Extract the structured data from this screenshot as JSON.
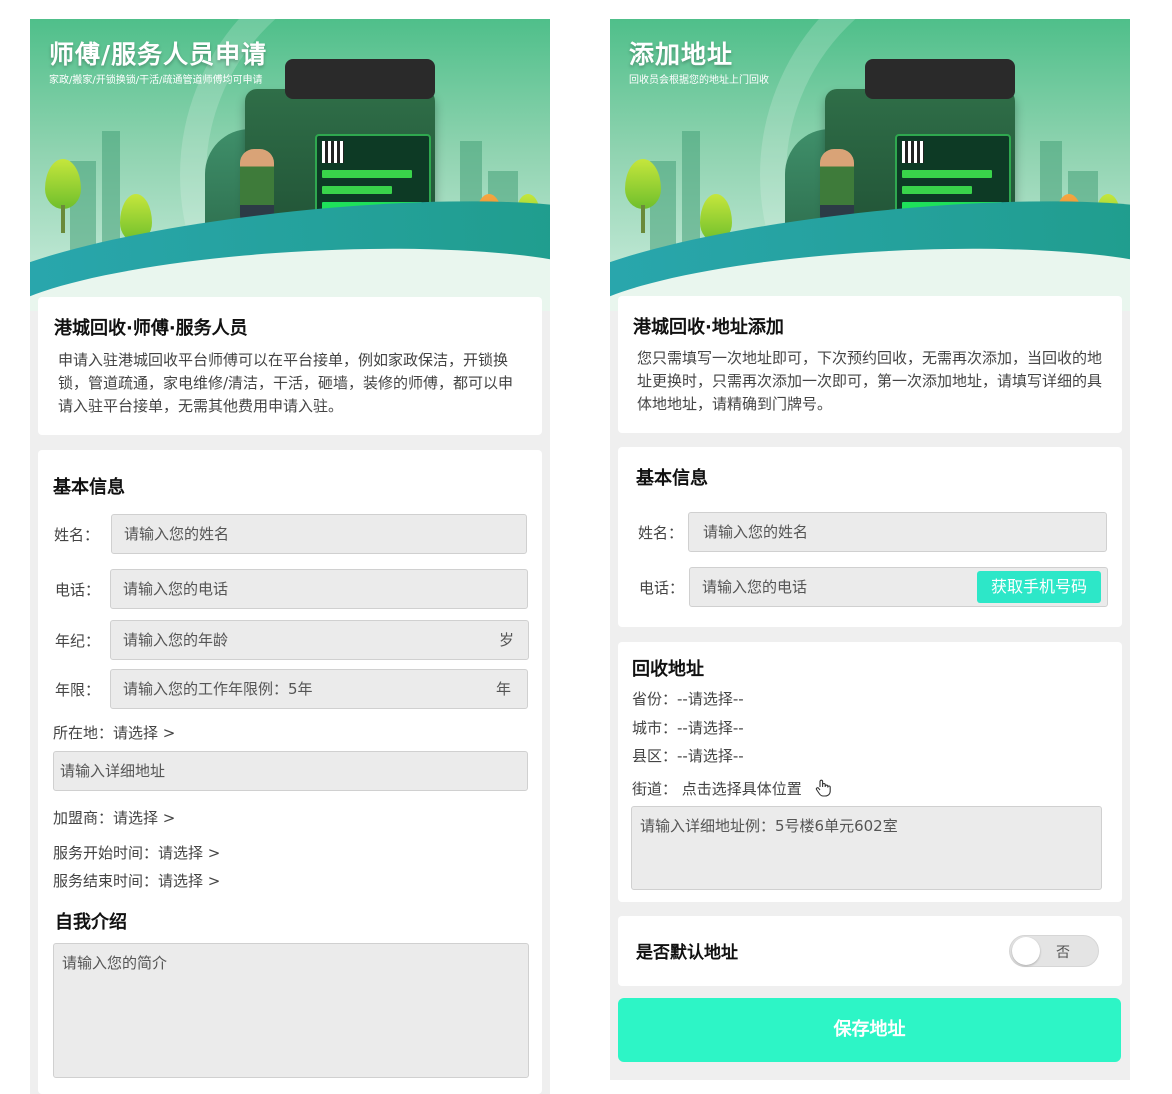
{
  "left": {
    "banner": {
      "title": "师傅/服务人员申请",
      "subtitle": "家政/搬家/开锁换锁/干活/疏通管道师傅均可申请"
    },
    "intro": {
      "title": "港城回收·师傅·服务人员",
      "text": "申请入驻港城回收平台师傅可以在平台接单，例如家政保洁，开锁换锁，管道疏通，家电维修/清洁，干活，砸墙，装修的师傅，都可以申请入驻平台接单，无需其他费用申请入驻。"
    },
    "basic": {
      "title": "基本信息",
      "name_label": "姓名：",
      "name_placeholder": "请输入您的姓名",
      "phone_label": "电话：",
      "phone_placeholder": "请输入您的电话",
      "age_label": "年纪：",
      "age_placeholder": "请输入您的年龄",
      "age_unit": "岁",
      "years_label": "年限：",
      "years_placeholder": "请输入您的工作年限例：5年",
      "years_unit": "年",
      "location": "所在地：请选择 >",
      "address_placeholder": "请输入详细地址",
      "franchise": "加盟商：请选择 >",
      "start_time": "服务开始时间：请选择 >",
      "end_time": "服务结束时间：请选择 >"
    },
    "intro_self": {
      "title": "自我介绍",
      "placeholder": "请输入您的简介"
    }
  },
  "right": {
    "banner": {
      "title": "添加地址",
      "subtitle": "回收员会根据您的地址上门回收"
    },
    "intro": {
      "title": "港城回收·地址添加",
      "text": "您只需填写一次地址即可，下次预约回收，无需再次添加，当回收的地址更换时，只需再次添加一次即可，第一次添加地址，请填写详细的具体地地址，请精确到门牌号。"
    },
    "basic": {
      "title": "基本信息",
      "name_label": "姓名：",
      "name_placeholder": "请输入您的姓名",
      "phone_label": "电话：",
      "phone_placeholder": "请输入您的电话",
      "get_phone_button": "获取手机号码"
    },
    "address": {
      "title": "回收地址",
      "province": "省份：--请选择--",
      "city": "城市：--请选择--",
      "district": "县区：--请选择--",
      "street": "街道：  点击选择具体位置",
      "detail_placeholder": "请输入详细地址例：5号楼6单元602室"
    },
    "default": {
      "label": "是否默认地址",
      "toggle_text": "否"
    },
    "save_button": "保存地址"
  }
}
